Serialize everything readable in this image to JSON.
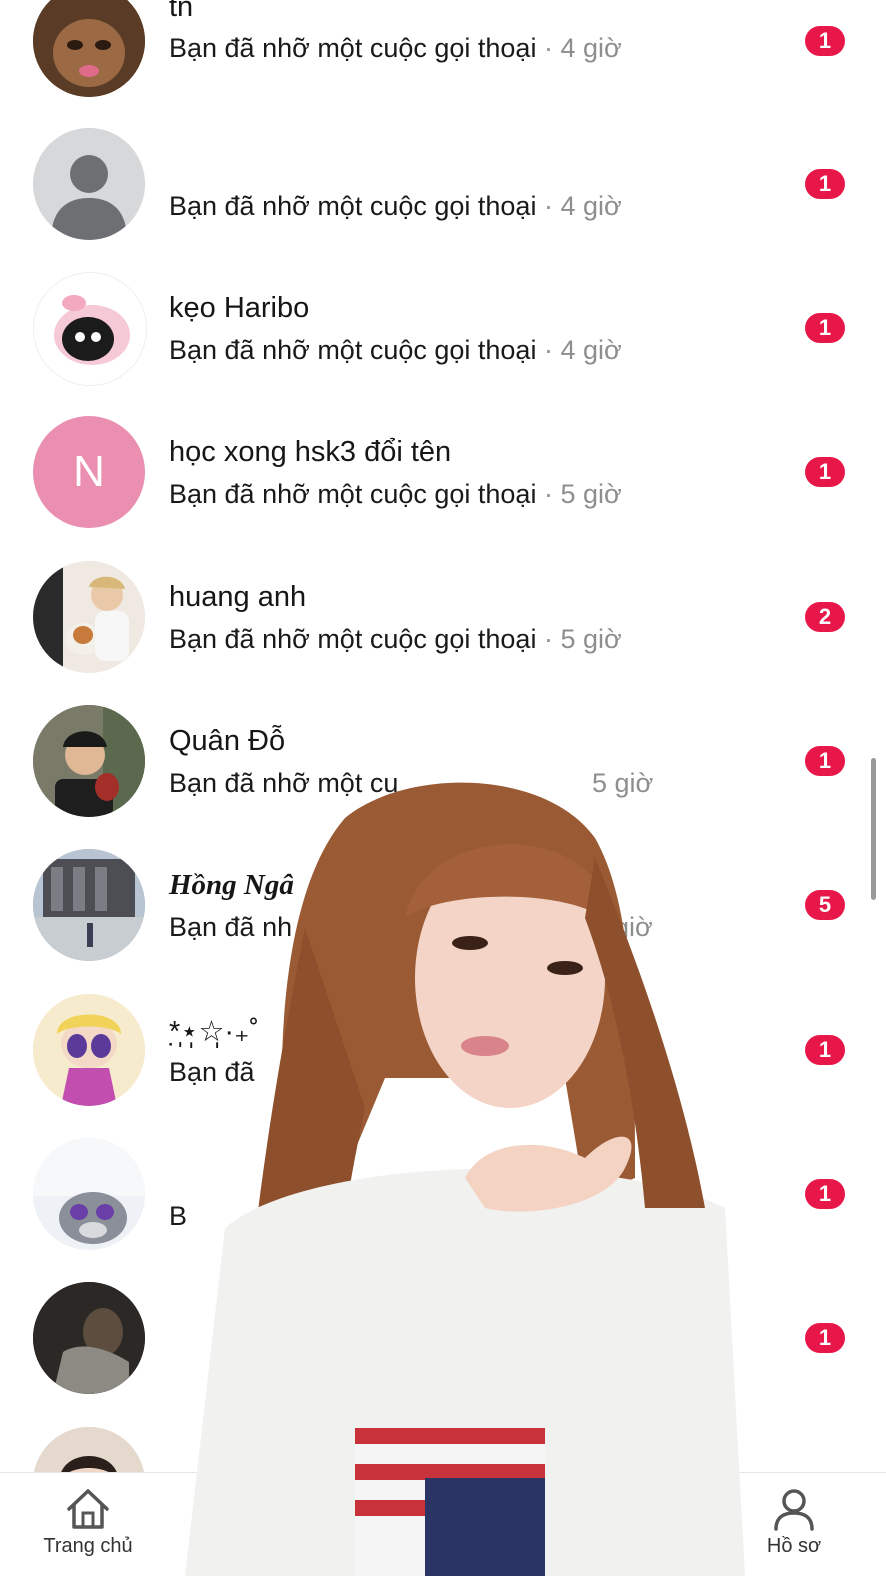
{
  "conversations": [
    {
      "name": "tn",
      "preview": "Bạn đã nhỡ một cuộc gọi thoại",
      "separator": "·",
      "time": "4 giờ",
      "unread": "1",
      "avatar_icon": "cat-face-avatar"
    },
    {
      "name": "",
      "preview": "Bạn đã nhỡ một cuộc gọi thoại",
      "separator": "·",
      "time": "4 giờ",
      "unread": "1",
      "avatar_icon": "default-person-avatar"
    },
    {
      "name": "kẹo Haribo",
      "preview": "Bạn đã nhỡ một cuộc gọi thoại",
      "separator": "·",
      "time": "4 giờ",
      "unread": "1",
      "avatar_icon": "cartoon-black-cat-avatar"
    },
    {
      "name": "học xong hsk3 đổi tên",
      "preview": "Bạn đã nhỡ một cuộc gọi thoại",
      "separator": "·",
      "time": "5 giờ",
      "unread": "1",
      "avatar_letter": "N"
    },
    {
      "name": "huang anh",
      "preview": "Bạn đã nhỡ một cuộc gọi thoại",
      "separator": "·",
      "time": "5 giờ",
      "unread": "2",
      "avatar_icon": "person-with-dog-avatar"
    },
    {
      "name": "Quân Đỗ",
      "preview": "Bạn đã nhỡ một cu",
      "separator": "",
      "time": "5 giờ",
      "unread": "1",
      "avatar_icon": "man-photo-avatar"
    },
    {
      "name": "Hồng Ngâ",
      "preview": "Bạn đã nh",
      "separator": "",
      "time": "giờ",
      "unread": "5",
      "avatar_icon": "city-building-avatar"
    },
    {
      "name": "*̣̩⋆̩☆̩·₊˚",
      "preview": "Bạn đã",
      "separator": "",
      "time": "",
      "unread": "1",
      "avatar_icon": "powerpuff-girl-avatar"
    },
    {
      "name": "",
      "preview": "B",
      "separator": "",
      "time": "",
      "unread": "1",
      "avatar_icon": "cartoon-rabbit-avatar"
    },
    {
      "name": "",
      "preview": "",
      "separator": "",
      "time": "",
      "unread": "1",
      "avatar_icon": "dark-photo-avatar"
    },
    {
      "name": "",
      "preview": "",
      "separator": "",
      "time": "",
      "unread": "",
      "avatar_icon": "girl-photo-avatar"
    }
  ],
  "bottom_nav": {
    "home_label": "Trang chủ",
    "profile_label": "Hồ sơ"
  },
  "colors": {
    "badge": "#e8174a",
    "letter_avatar": "#ea8fb0"
  }
}
